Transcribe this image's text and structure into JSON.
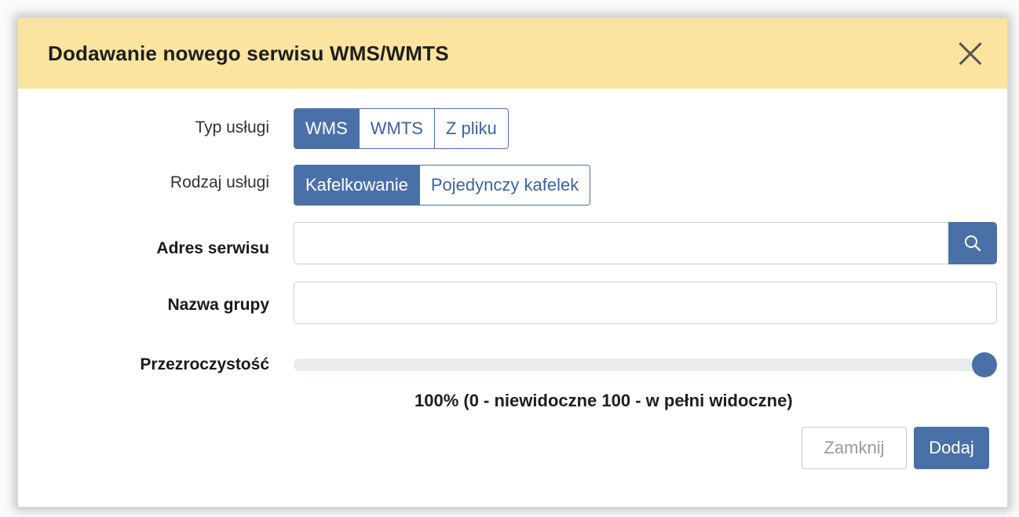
{
  "dialog": {
    "title": "Dodawanie nowego serwisu WMS/WMTS",
    "close_icon": "close-icon"
  },
  "form": {
    "service_type": {
      "label": "Typ usługi",
      "options": [
        "WMS",
        "WMTS",
        "Z pliku"
      ],
      "selected": "WMS"
    },
    "service_kind": {
      "label": "Rodzaj usługi",
      "options": [
        "Kafelkowanie",
        "Pojedynczy kafelek"
      ],
      "selected": "Kafelkowanie"
    },
    "address": {
      "label": "Adres serwisu",
      "value": "",
      "search_icon": "search-icon"
    },
    "group_name": {
      "label": "Nazwa grupy",
      "value": ""
    },
    "opacity": {
      "label": "Przezroczystość",
      "value_fraction": 1.0,
      "hint": "100% (0 - niewidoczne 100 - w pełni widoczne)"
    }
  },
  "footer": {
    "close_label": "Zamknij",
    "add_label": "Dodaj"
  },
  "colors": {
    "header_bg": "#fbe4a0",
    "accent": "#4a70a8"
  }
}
